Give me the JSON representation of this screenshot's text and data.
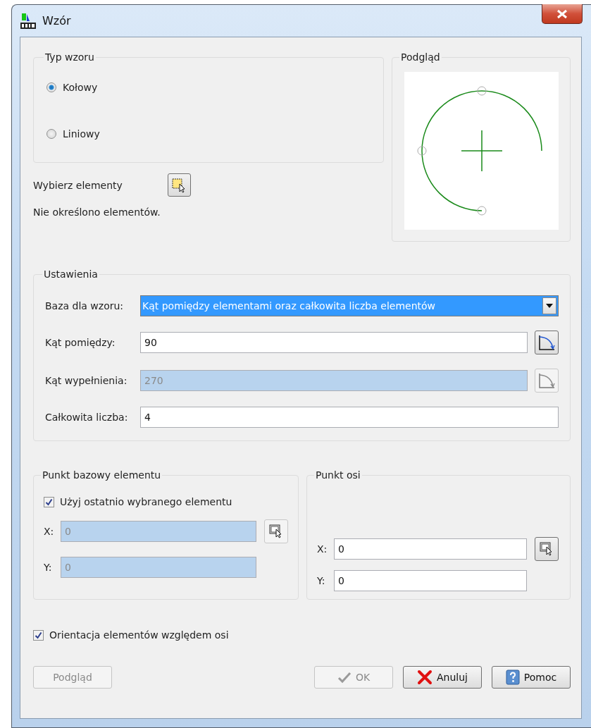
{
  "window": {
    "title": "Wzór"
  },
  "type_group": {
    "title": "Typ wzoru",
    "options": [
      {
        "label": "Kołowy",
        "selected": true
      },
      {
        "label": "Liniowy",
        "selected": false
      }
    ]
  },
  "select_elements": {
    "label": "Wybierz elementy",
    "status": "Nie określono elementów."
  },
  "preview": {
    "title": "Podgląd"
  },
  "settings": {
    "title": "Ustawienia",
    "base": {
      "label": "Baza dla wzoru:",
      "value": "Kąt pomiędzy elementami oraz całkowita liczba elementów"
    },
    "fields": [
      {
        "label": "Kąt pomiędzy:",
        "value": "90",
        "disabled": false,
        "kind": "angle"
      },
      {
        "label": "Kąt wypełnienia:",
        "value": "270",
        "disabled": true,
        "kind": "angle"
      },
      {
        "label": "Całkowita liczba:",
        "value": "4",
        "disabled": false,
        "kind": "plain"
      }
    ]
  },
  "base_point": {
    "title": "Punkt bazowy elementu",
    "use_last": {
      "label": "Użyj ostatnio wybranego elementu",
      "checked": true
    },
    "fields": [
      {
        "label": "X:",
        "value": "0",
        "disabled": true,
        "kind": "pick"
      },
      {
        "label": "Y:",
        "value": "0",
        "disabled": true,
        "kind": "plain"
      }
    ]
  },
  "axis_point": {
    "title": "Punkt osi",
    "fields": [
      {
        "label": "X:",
        "value": "0",
        "disabled": false,
        "kind": "pick"
      },
      {
        "label": "Y:",
        "value": "0",
        "disabled": false,
        "kind": "plain"
      }
    ]
  },
  "orientation": {
    "label": "Orientacja elementów względem osi",
    "checked": true
  },
  "buttons": [
    {
      "label": "Podgląd",
      "kind": "preview",
      "disabled": true
    },
    {
      "label": "OK",
      "kind": "ok",
      "disabled": true
    },
    {
      "label": "Anuluj",
      "kind": "cancel",
      "disabled": false
    },
    {
      "label": "Pomoc",
      "kind": "help",
      "disabled": false
    }
  ]
}
